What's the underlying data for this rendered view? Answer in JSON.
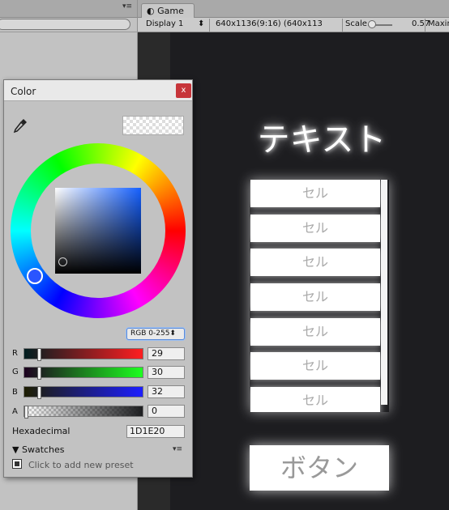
{
  "left_pane": {
    "menu_icon": "menu-icon"
  },
  "game": {
    "tab_label": "Game",
    "toolbar": {
      "display": "Display 1",
      "resolution": "640x1136(9:16) (640x113",
      "scale_label": "Scale",
      "scale_value": "0.57",
      "maximize_label": "Maxim"
    },
    "title_text": "テキスト",
    "list_cells": [
      "セル",
      "セル",
      "セル",
      "セル",
      "セル",
      "セル",
      "セル"
    ],
    "button_label": "ボタン"
  },
  "color_window": {
    "title": "Color",
    "close_label": "x",
    "mode": "RGB 0-255",
    "channels": [
      {
        "label": "R",
        "value": "29"
      },
      {
        "label": "G",
        "value": "30"
      },
      {
        "label": "B",
        "value": "32"
      },
      {
        "label": "A",
        "value": "0"
      }
    ],
    "hex_label": "Hexadecimal",
    "hex_value": "1D1E20",
    "swatches_label": "Swatches",
    "preset_hint": "Click to add new preset",
    "colors": {
      "current": "#1D1E20",
      "close_button": "#c7353a"
    }
  }
}
